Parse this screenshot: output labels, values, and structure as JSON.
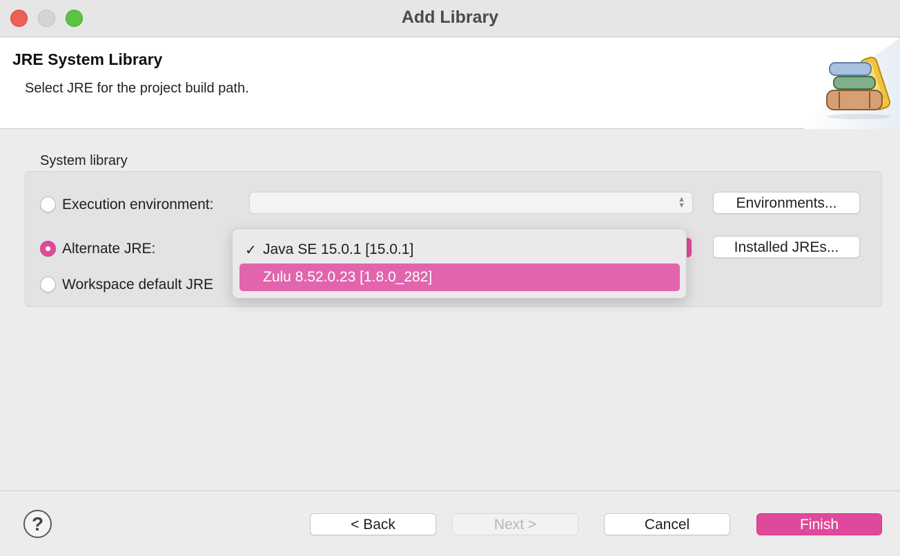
{
  "window": {
    "title": "Add Library"
  },
  "header": {
    "title": "JRE System Library",
    "description": "Select JRE for the project build path."
  },
  "group": {
    "label": "System library",
    "options": {
      "execution_environment": "Execution environment:",
      "alternate_jre": "Alternate JRE:",
      "workspace_default": "Workspace default JRE"
    },
    "selected": "alternate_jre",
    "buttons": {
      "environments": "Environments...",
      "installed_jres": "Installed JREs..."
    }
  },
  "dropdown": {
    "items": [
      {
        "label": "Java SE 15.0.1 [15.0.1]",
        "checked": true
      },
      {
        "label": "Zulu 8.52.0.23 [1.8.0_282]",
        "highlighted": true
      }
    ]
  },
  "footer": {
    "help": "?",
    "back": "< Back",
    "next": "Next >",
    "cancel": "Cancel",
    "finish": "Finish"
  },
  "colors": {
    "accent": "#e0499b",
    "highlight": "#e264ad"
  }
}
